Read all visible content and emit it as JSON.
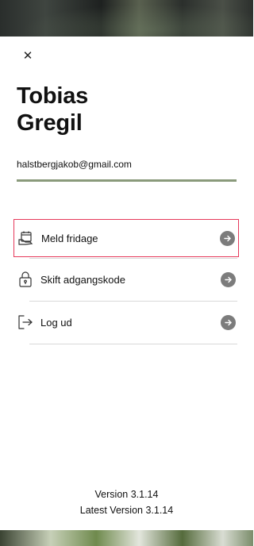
{
  "profile": {
    "first_name": "Tobias",
    "last_name": "Gregil",
    "email": "halstbergjakob@gmail.com"
  },
  "menu": {
    "items": [
      {
        "label": "Meld fridage",
        "icon": "calendar-hand-icon"
      },
      {
        "label": "Skift adgangskode",
        "icon": "lock-icon"
      },
      {
        "label": "Log ud",
        "icon": "logout-icon"
      }
    ]
  },
  "footer": {
    "version": "Version 3.1.14",
    "latest_version": "Latest Version 3.1.14"
  },
  "colors": {
    "accent_line": "#8a9a7b",
    "active_border": "#e63a5b",
    "arrow_bg": "#7c7c7c"
  }
}
